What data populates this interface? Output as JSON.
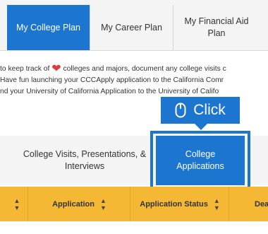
{
  "top_tabs": [
    {
      "label": "My College Plan",
      "active": true
    },
    {
      "label": "My Career Plan",
      "active": false
    },
    {
      "label": "My Financial Aid Plan",
      "active": false
    }
  ],
  "description": {
    "line1_before": "to keep track of ",
    "line1_after": " colleges and majors, document any college visits c",
    "line2": "Have fun launching your CCCApply application to the California Comr",
    "line3": "nd your University of California Application to the University of Califo"
  },
  "callout": {
    "label": "Click",
    "icon": "mouse-icon"
  },
  "sub_tabs": [
    {
      "label": "College Visits, Presentations, & Interviews",
      "active": false
    },
    {
      "label": "College Applications",
      "active": true
    }
  ],
  "table": {
    "headers": [
      "",
      "Application",
      "Application Status",
      "Dea"
    ],
    "sort_icon": "sort-icon"
  },
  "colors": {
    "accent": "#1c76d0",
    "header_bg": "#f4b834",
    "heart": "#e53935"
  }
}
